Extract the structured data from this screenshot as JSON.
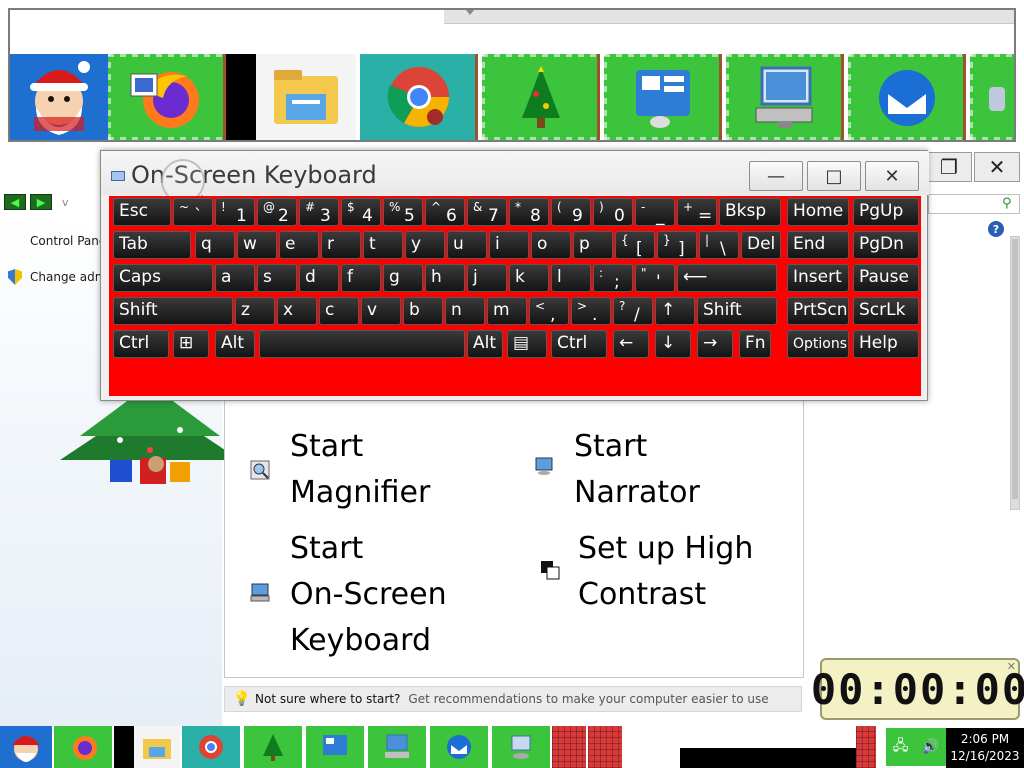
{
  "osk": {
    "title": "On-Screen Keyboard",
    "minimize": "—",
    "maximize": "□",
    "close": "✕",
    "rows": [
      [
        {
          "m": "Esc"
        },
        {
          "s": "~",
          "b": "`"
        },
        {
          "s": "!",
          "b": "1"
        },
        {
          "s": "@",
          "b": "2"
        },
        {
          "s": "#",
          "b": "3"
        },
        {
          "s": "$",
          "b": "4"
        },
        {
          "s": "%",
          "b": "5"
        },
        {
          "s": "^",
          "b": "6"
        },
        {
          "s": "&",
          "b": "7"
        },
        {
          "s": "*",
          "b": "8"
        },
        {
          "s": "(",
          "b": "9"
        },
        {
          "s": ")",
          "b": "0"
        },
        {
          "s": "-",
          "b": "_"
        },
        {
          "s": "+",
          "b": "="
        },
        {
          "m": "Bksp"
        },
        {
          "m": "Home"
        },
        {
          "m": "PgUp"
        }
      ],
      [
        {
          "m": "Tab"
        },
        {
          "m": "q"
        },
        {
          "m": "w"
        },
        {
          "m": "e"
        },
        {
          "m": "r"
        },
        {
          "m": "t"
        },
        {
          "m": "y"
        },
        {
          "m": "u"
        },
        {
          "m": "i"
        },
        {
          "m": "o"
        },
        {
          "m": "p"
        },
        {
          "s": "{",
          "b": "["
        },
        {
          "s": "}",
          "b": "]"
        },
        {
          "s": "|",
          "b": "\\"
        },
        {
          "m": "Del"
        },
        {
          "m": "End"
        },
        {
          "m": "PgDn"
        }
      ],
      [
        {
          "m": "Caps"
        },
        {
          "m": "a"
        },
        {
          "m": "s"
        },
        {
          "m": "d"
        },
        {
          "m": "f"
        },
        {
          "m": "g"
        },
        {
          "m": "h"
        },
        {
          "m": "j"
        },
        {
          "m": "k"
        },
        {
          "m": "l"
        },
        {
          "s": ":",
          "b": ";"
        },
        {
          "s": "\"",
          "b": "'"
        },
        {
          "m": "⟵"
        },
        {
          "m": "Insert"
        },
        {
          "m": "Pause"
        }
      ],
      [
        {
          "m": "Shift"
        },
        {
          "m": "z"
        },
        {
          "m": "x"
        },
        {
          "m": "c"
        },
        {
          "m": "v"
        },
        {
          "m": "b"
        },
        {
          "m": "n"
        },
        {
          "m": "m"
        },
        {
          "s": "<",
          "b": ","
        },
        {
          "s": ">",
          "b": "."
        },
        {
          "s": "?",
          "b": "/"
        },
        {
          "m": "↑"
        },
        {
          "m": "Shift"
        },
        {
          "m": "PrtScn"
        },
        {
          "m": "ScrLk"
        }
      ],
      [
        {
          "m": "Ctrl"
        },
        {
          "m": "⊞"
        },
        {
          "m": "Alt"
        },
        {
          "m": ""
        },
        {
          "m": "Alt"
        },
        {
          "m": "▤"
        },
        {
          "m": "Ctrl"
        },
        {
          "m": "←"
        },
        {
          "m": "↓"
        },
        {
          "m": "→"
        },
        {
          "m": "Fn"
        },
        {
          "m": "Options"
        },
        {
          "m": "Help"
        }
      ]
    ]
  },
  "explorer": {
    "breadcrumb_left": "Control Panel",
    "change_admin": "Change admi",
    "tasks": [
      {
        "line1": "Start",
        "line2": "Magnifier",
        "line3": ""
      },
      {
        "line1": "Start",
        "line2": "Narrator",
        "line3": ""
      },
      {
        "line1": "Start",
        "line2": "On-Screen",
        "line3": "Keyboard"
      },
      {
        "line1": "Set up High",
        "line2": "Contrast",
        "line3": ""
      }
    ],
    "tip_question": "Not sure where to start?",
    "tip_link": "Get recommendations to make your computer easier to use"
  },
  "timer": {
    "value": "00:00:00"
  },
  "taskbar": {
    "clock_time": "2:06 PM",
    "clock_date": "12/16/2023"
  },
  "colors": {
    "tile_green": "#3dc43d",
    "keyboard_bg": "#ff0000",
    "key_dark": "#1f1f1f"
  },
  "icons": {
    "topstrip": [
      "santa-icon",
      "firefox-icon",
      "file-explorer-icon",
      "chrome-icon",
      "christmas-tree-icon",
      "control-panel-icon",
      "remote-desktop-icon",
      "thunderbird-icon",
      "partial-icon"
    ]
  }
}
